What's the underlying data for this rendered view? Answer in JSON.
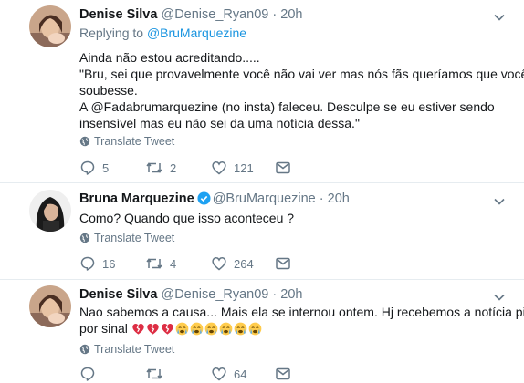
{
  "tweets": [
    {
      "name": "Denise Silva",
      "handle": "@Denise_Ryan09",
      "sep": "·",
      "time": "20h",
      "replying_prefix": "Replying to",
      "replying_to": "@BruMarquezine",
      "lines": [
        "Ainda não estou acreditando.....",
        "\"Bru, sei que provavelmente você não vai ver mas nós fãs queríamos que você",
        "soubesse.",
        "A @Fadabrumarquezine (no insta) faleceu. Desculpe se eu estiver sendo",
        "insensível mas eu não sei da uma notícia dessa.\""
      ],
      "translate": "Translate Tweet",
      "replies": "5",
      "retweets": "2",
      "likes": "121"
    },
    {
      "name": "Bruna Marquezine",
      "verified": true,
      "handle": "@BruMarquezine",
      "sep": "·",
      "time": "20h",
      "lines": [
        "Como? Quando que isso aconteceu ?"
      ],
      "translate": "Translate Tweet",
      "replies": "16",
      "retweets": "4",
      "likes": "264"
    },
    {
      "name": "Denise Silva",
      "handle": "@Denise_Ryan09",
      "sep": "·",
      "time": "20h",
      "lines": [
        "Nao sabemos a causa... Mais ela se internou ontem. Hj recebemos a notícia pior",
        "por sinal"
      ],
      "emoji_sequence": [
        "broken-heart",
        "broken-heart",
        "broken-heart",
        "crying-face",
        "crying-face",
        "crying-face",
        "crying-face",
        "crying-face",
        "crying-face"
      ],
      "translate": "Translate Tweet",
      "likes": "64"
    }
  ],
  "colors": {
    "link": "#1b95e0",
    "muted": "#657786",
    "verified": "#1da1f2",
    "broken_heart": "#dd2e44",
    "crying_face": "#ffcc4d"
  }
}
